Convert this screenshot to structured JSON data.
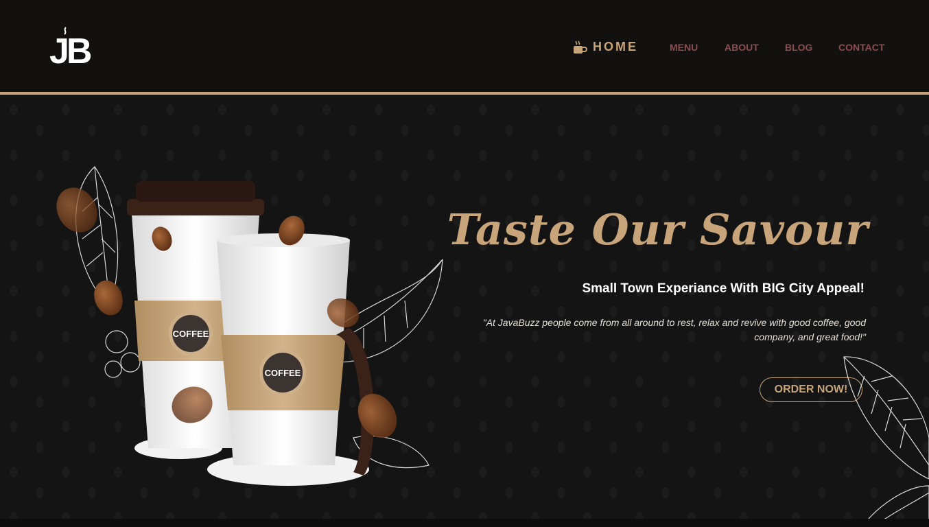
{
  "brand": {
    "logo_text": "JB",
    "logo_icon": "coffee-steam-icon"
  },
  "nav": {
    "home_icon": "coffee-cup-icon",
    "items": [
      {
        "label": "HOME"
      },
      {
        "label": "MENU"
      },
      {
        "label": "ABOUT"
      },
      {
        "label": "BLOG"
      },
      {
        "label": "CONTACT"
      }
    ]
  },
  "hero": {
    "title": "Taste Our Savour",
    "subtitle": "Small Town Experiance With BIG City Appeal!",
    "quote": "\"At JavaBuzz people come from all around to rest, relax and revive with good coffee, good company, and great food!\"",
    "cta_label": "ORDER NOW!",
    "cup_label": "COFFEE"
  },
  "colors": {
    "accent": "#c8a47a",
    "nav_link": "#8b4d50",
    "background": "#141414"
  }
}
